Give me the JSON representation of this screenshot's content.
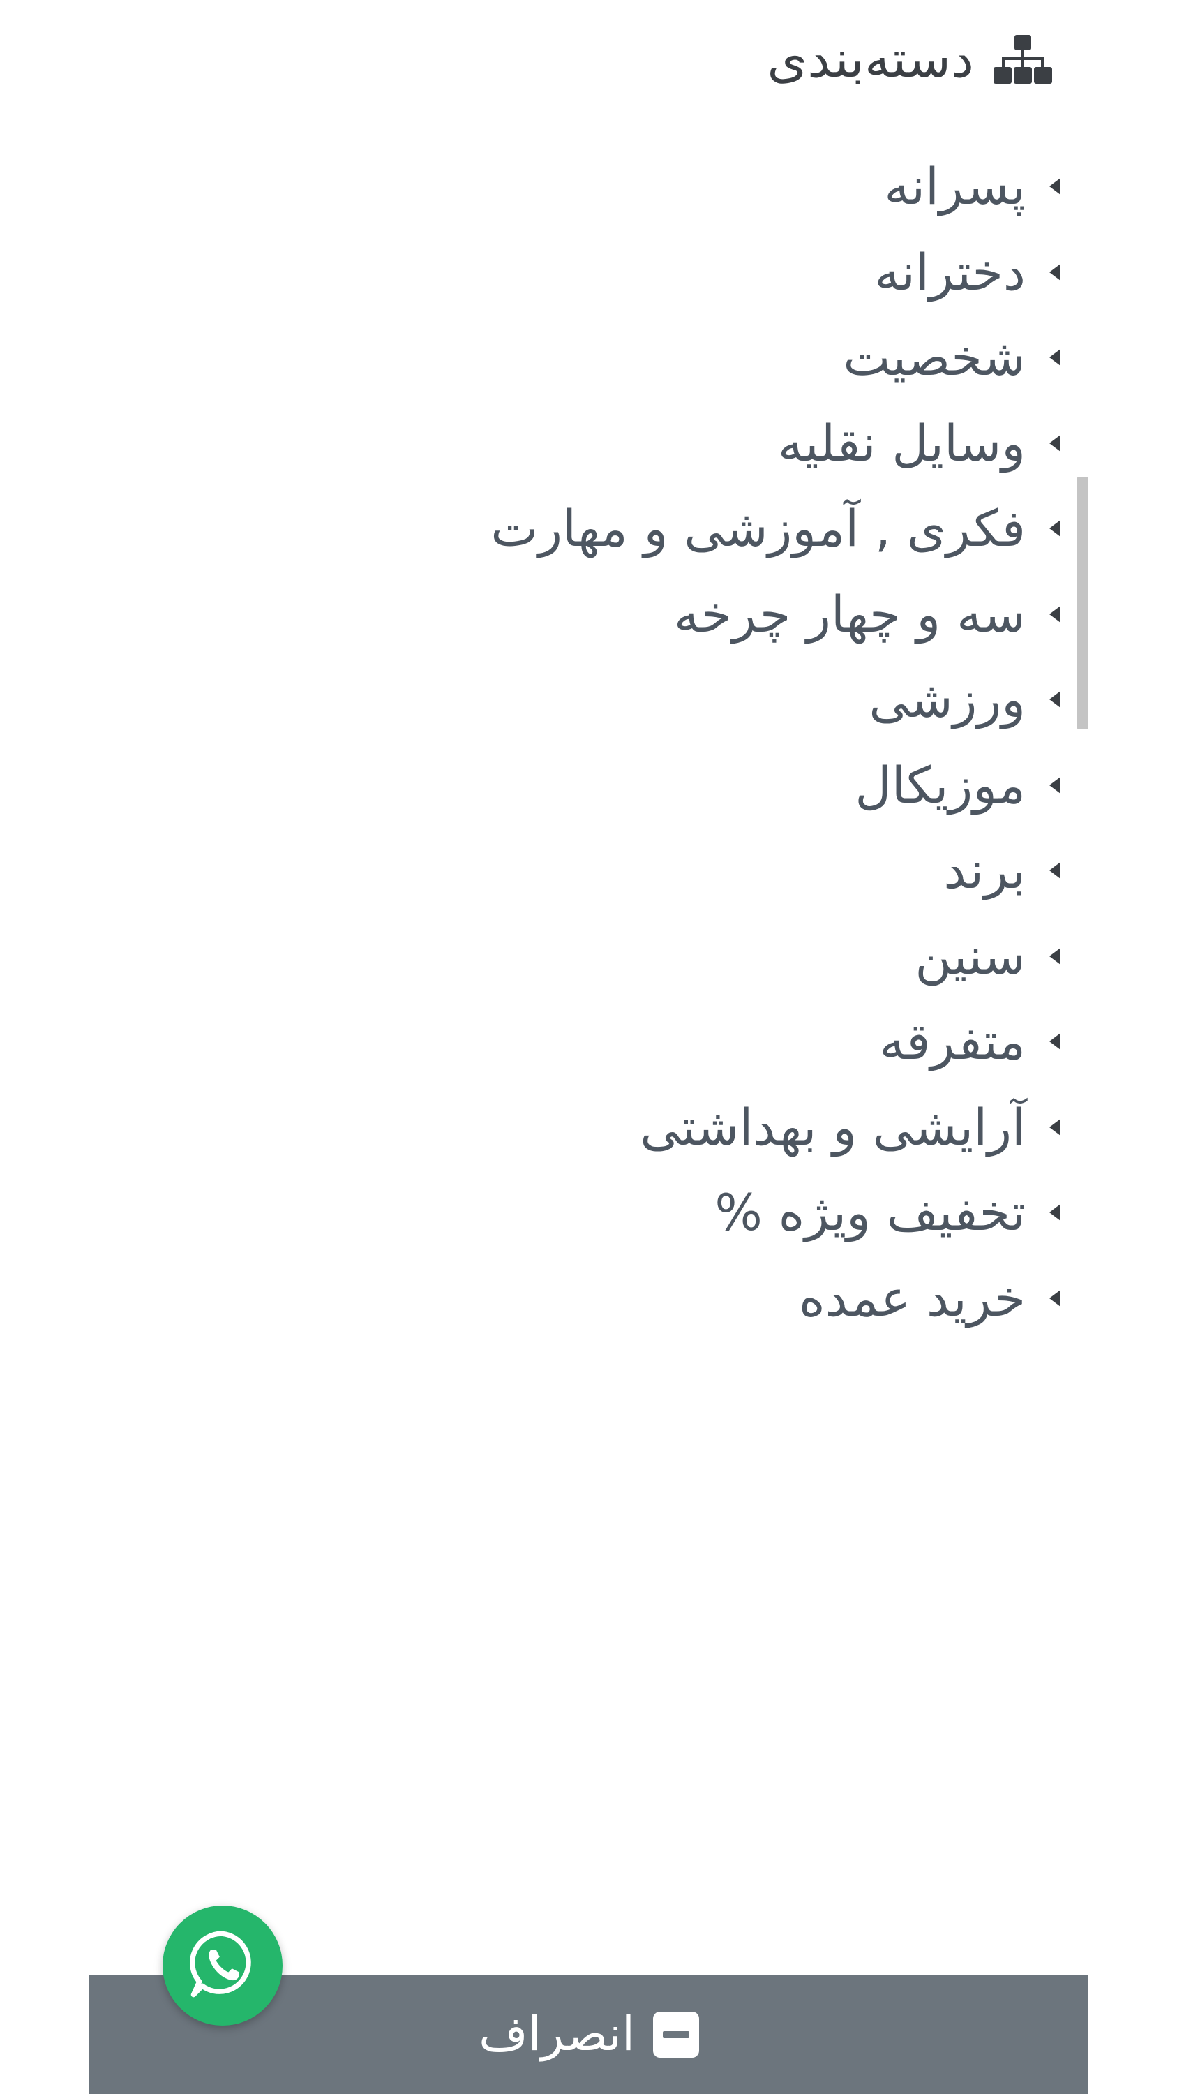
{
  "header": {
    "title": "دسته‌بندی",
    "icon": "sitemap-icon"
  },
  "categories": [
    {
      "label": "پسرانه"
    },
    {
      "label": "دخترانه"
    },
    {
      "label": "شخصیت"
    },
    {
      "label": "وسایل نقلیه"
    },
    {
      "label": "فکری , آموزشی و مهارت"
    },
    {
      "label": "سه و چهار چرخه"
    },
    {
      "label": "ورزشی"
    },
    {
      "label": "موزیکال"
    },
    {
      "label": "برند"
    },
    {
      "label": "سنین"
    },
    {
      "label": "متفرقه"
    },
    {
      "label": "آرایشی و بهداشتی"
    },
    {
      "label": "تخفیف ویژه %"
    },
    {
      "label": "خرید عمده"
    }
  ],
  "footer": {
    "cancel_label": "انصراف",
    "cancel_icon": "minus-square-icon",
    "bar_color": "#6c757d"
  },
  "whatsapp": {
    "icon": "whatsapp-icon",
    "color": "#25b66b"
  }
}
